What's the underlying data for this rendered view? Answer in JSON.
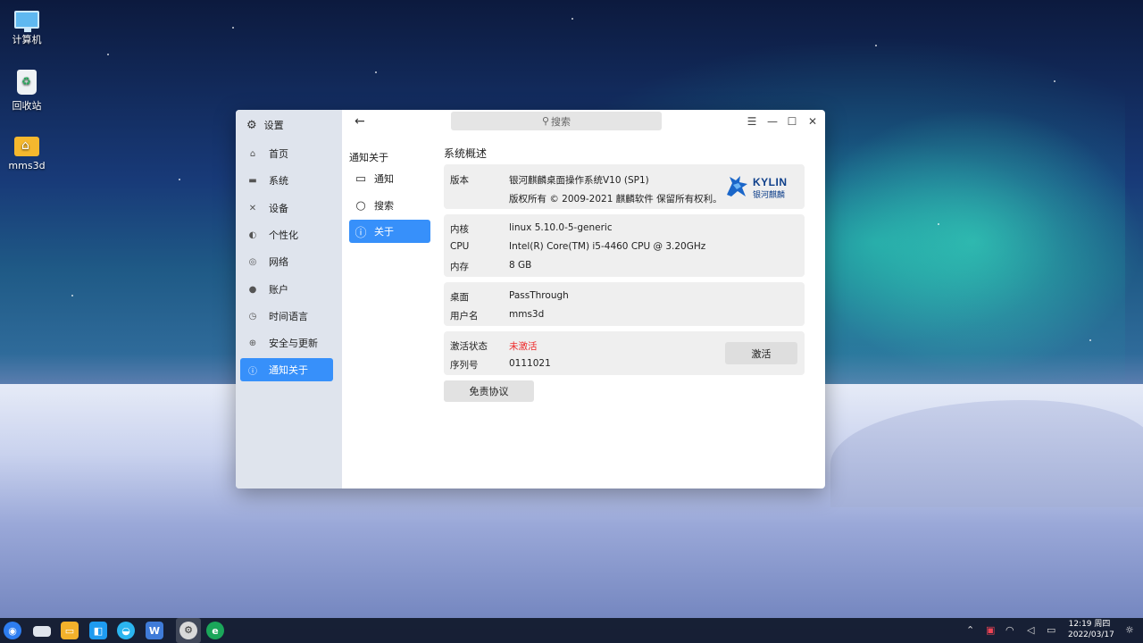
{
  "desktop": {
    "icons": [
      {
        "label": "计算机",
        "icon": "computer-icon"
      },
      {
        "label": "回收站",
        "icon": "recycle-bin-icon"
      },
      {
        "label": "mms3d",
        "icon": "home-folder-icon"
      }
    ]
  },
  "window": {
    "title": "设置",
    "search_placeholder": "搜索",
    "sidebar": {
      "items": [
        {
          "label": "首页",
          "icon": "home-icon"
        },
        {
          "label": "系统",
          "icon": "monitor-icon"
        },
        {
          "label": "设备",
          "icon": "devices-icon"
        },
        {
          "label": "个性化",
          "icon": "palette-icon"
        },
        {
          "label": "网络",
          "icon": "globe-icon"
        },
        {
          "label": "账户",
          "icon": "user-icon"
        },
        {
          "label": "时间语言",
          "icon": "clock-icon"
        },
        {
          "label": "安全与更新",
          "icon": "shield-icon"
        },
        {
          "label": "通知关于",
          "icon": "info-icon",
          "active": true
        }
      ]
    },
    "subnav": {
      "title": "通知关于",
      "items": [
        {
          "label": "通知",
          "icon": "message-icon"
        },
        {
          "label": "搜索",
          "icon": "search-icon"
        },
        {
          "label": "关于",
          "icon": "info-icon",
          "active": true
        }
      ]
    },
    "content": {
      "title": "系统概述",
      "version": {
        "label": "版本",
        "value": "银河麒麟桌面操作系统V10 (SP1)",
        "copyright": "版权所有 © 2009-2021 麒麟软件 保留所有权利。",
        "logo_text": "KYLIN",
        "logo_sub": "银河麒麟"
      },
      "hardware": [
        {
          "label": "内核",
          "value": "linux 5.10.0-5-generic"
        },
        {
          "label": "CPU",
          "value": "Intel(R) Core(TM) i5-4460  CPU @ 3.20GHz"
        },
        {
          "label": "内存",
          "value": "8 GB"
        }
      ],
      "desktop_info": [
        {
          "label": "桌面",
          "value": "PassThrough"
        },
        {
          "label": "用户名",
          "value": "mms3d"
        }
      ],
      "activation": {
        "status_label": "激活状态",
        "status_value": "未激活",
        "serial_label": "序列号",
        "serial_value": "0111021",
        "activate_button": "激活"
      },
      "disclaimer_button": "免责协议"
    }
  },
  "taskbar": {
    "clock_time": "12:19 周四",
    "clock_date": "2022/03/17"
  },
  "colors": {
    "accent": "#3790fa",
    "inactive_status": "#ee2b2b"
  }
}
